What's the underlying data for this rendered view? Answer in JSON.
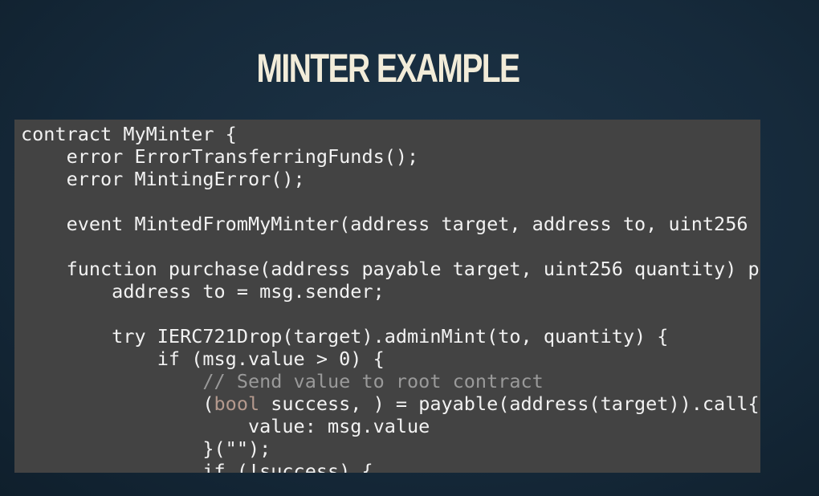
{
  "slide": {
    "title": "MINTER EXAMPLE"
  },
  "code": {
    "lines": [
      "contract MyMinter {",
      "    error ErrorTransferringFunds();",
      "    error MintingError();",
      "",
      "    event MintedFromMyMinter(address target, address to, uint256",
      "",
      "    function purchase(address payable target, uint256 quantity) p",
      "        address to = msg.sender;",
      "",
      "        try IERC721Drop(target).adminMint(to, quantity) {",
      "            if (msg.value > 0) {",
      "                // Send value to root contract",
      "                (",
      "bool",
      " success, ) = payable(address(target)).call{",
      "                    value: msg.value",
      "                }(\"\");",
      "                if (!success) {"
    ]
  },
  "colors": {
    "background": "#162a3b",
    "panel": "#434343",
    "title": "#f2ecd9",
    "code_text": "#f2f2f2",
    "comment": "#9a9a9a",
    "keyword": "#b59a8e"
  }
}
